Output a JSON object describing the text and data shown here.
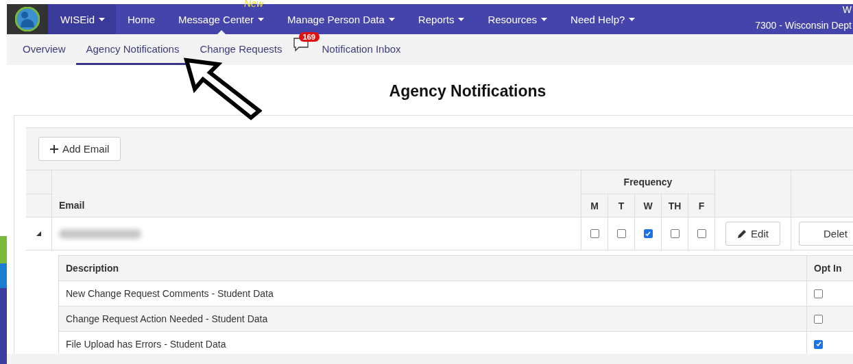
{
  "nav": {
    "brand": "WISEid",
    "items": [
      {
        "label": "Home",
        "dropdown": false,
        "selected": false
      },
      {
        "label": "Message Center",
        "dropdown": true,
        "selected": true,
        "badge": "New"
      },
      {
        "label": "Manage Person Data",
        "dropdown": true,
        "selected": false
      },
      {
        "label": "Reports",
        "dropdown": true,
        "selected": false
      },
      {
        "label": "Resources",
        "dropdown": true,
        "selected": false
      },
      {
        "label": "Need Help?",
        "dropdown": true,
        "selected": false
      }
    ],
    "user_initial": "W",
    "agency": "7300 - Wisconsin Dept"
  },
  "subnav": [
    {
      "label": "Overview",
      "selected": false
    },
    {
      "label": "Agency Notifications",
      "selected": true
    },
    {
      "label": "Change Requests",
      "selected": false
    },
    {
      "label": "Notification Inbox",
      "selected": false,
      "kind": "badge-icon",
      "count": "169"
    }
  ],
  "title": "Agency Notifications",
  "add_button": "Add Email",
  "table": {
    "group_header": "Frequency",
    "email_header": "Email",
    "days": [
      "M",
      "T",
      "W",
      "TH",
      "F"
    ],
    "rows": [
      {
        "expanded": true,
        "days_checked": [
          false,
          false,
          true,
          false,
          false
        ],
        "edit": "Edit",
        "delete": "Delet"
      }
    ]
  },
  "subtable": {
    "columns": [
      "Description",
      "Opt In"
    ],
    "rows": [
      {
        "description": "New Change Request Comments - Student Data",
        "checked": false
      },
      {
        "description": "Change Request Action Needed - Student Data",
        "checked": false
      },
      {
        "description": "File Upload has Errors - Student Data",
        "checked": true
      }
    ]
  }
}
